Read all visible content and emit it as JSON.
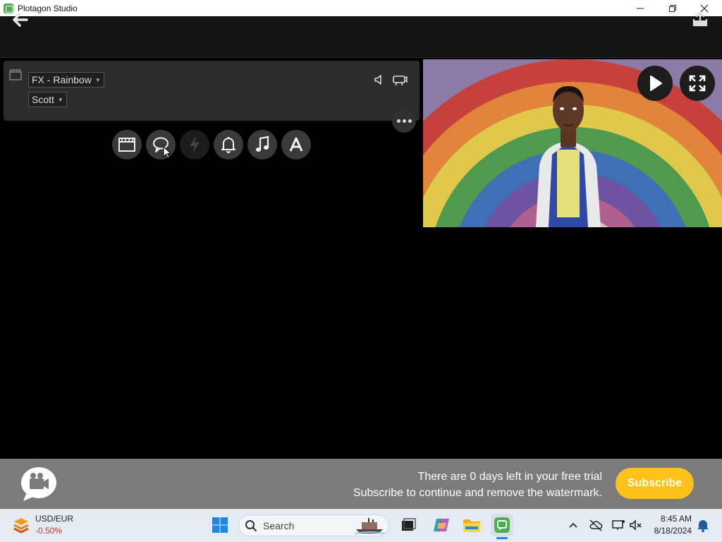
{
  "window": {
    "title": "Plotagon Studio",
    "controls": {
      "minimize": "—",
      "maximize": "❐",
      "close": "✕"
    }
  },
  "scene": {
    "location_dropdown": "FX - Rainbow",
    "character_dropdown": "Scott"
  },
  "line_buttons": [
    {
      "icon": "clapperboard-icon",
      "enabled": true
    },
    {
      "icon": "speech-bubble-icon",
      "enabled": true
    },
    {
      "icon": "lightning-icon",
      "enabled": false
    },
    {
      "icon": "bell-icon",
      "enabled": true
    },
    {
      "icon": "music-note-icon",
      "enabled": true
    },
    {
      "icon": "text-icon",
      "enabled": true
    }
  ],
  "banner": {
    "line1": "There are 0 days left in your free trial",
    "line2": "Subscribe to continue and remove the watermark.",
    "subscribe_label": "Subscribe"
  },
  "taskbar": {
    "ticker_name": "USD/EUR",
    "ticker_value": "-0.50%",
    "search_placeholder": "Search",
    "time": "8:45 AM",
    "date": "8/18/2024"
  },
  "colors": {
    "accent_yellow": "#ffc21a",
    "negative_red": "#c0392b",
    "banner_gray": "#7b7b7b"
  }
}
